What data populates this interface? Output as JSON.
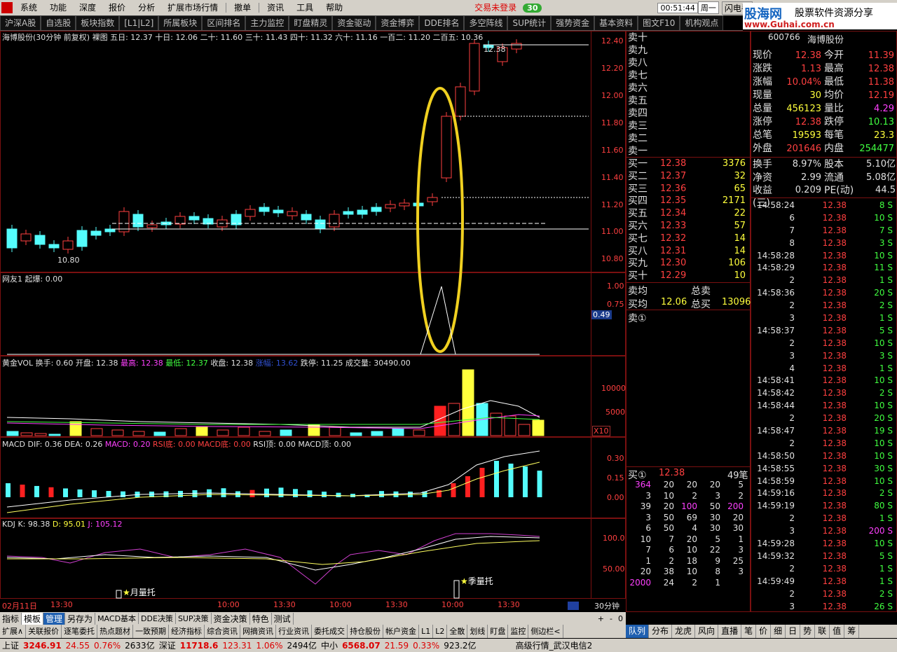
{
  "menu": {
    "items": [
      "系统",
      "功能",
      "深度",
      "报价",
      "分析",
      "扩展市场行情",
      "撤单",
      "资讯",
      "工具",
      "帮助"
    ],
    "login": "交易未登录",
    "badge": "30",
    "time": "00:51:44",
    "weekday": "周一",
    "flash": "闪电手"
  },
  "tabs": [
    "沪深A股",
    "自选股",
    "板块指数",
    "[L1|L2]",
    "所属板块",
    "区间排名",
    "主力监控",
    "盯盘精灵",
    "资金驱动",
    "资金博弈",
    "DDE排名",
    "多空阵线",
    "SUP统计",
    "强势资金",
    "基本资料",
    "图文F10",
    "机构观点"
  ],
  "logo": {
    "name": "股海网",
    "tagline": "股票软件资源分享",
    "url": "www.Guhai.com.cn",
    "stock_code": "600766",
    "stock_name": "海博股份"
  },
  "chart": {
    "title_stock": "海博股份(30分钟 前复权) 裸图",
    "ma": [
      "五日: 12.37",
      "十日: 12.06",
      "二十: 11.60",
      "三十: 11.43",
      "四十: 11.32",
      "六十: 11.16",
      "一百二: 11.20",
      "二百五: 10.36"
    ],
    "price_axis": [
      "12.40",
      "12.20",
      "12.00",
      "11.80",
      "11.60",
      "11.40",
      "11.20",
      "11.00",
      "10.80"
    ],
    "low_label": "10.80",
    "high_label": "12.38",
    "ind1_title": "网友1",
    "ind1_label": "起爆: 0.00",
    "ind1_axis": [
      "1.00",
      "0.75",
      "0.49"
    ],
    "vol_title": "黄金VOL",
    "vol_info": [
      "换手: 0.60",
      "开盘: 12.38",
      "最高: 12.38",
      "最低: 12.37",
      "收盘: 12.38",
      "涨幅: 13.62",
      "跌停: 11.25",
      "成交量: 30490.00"
    ],
    "vol_axis": [
      "10000",
      "5000",
      "X10"
    ],
    "macd_title": "MACD",
    "macd_info": [
      "DIF: 0.36",
      "DEA: 0.26",
      "MACD: 0.20",
      "RSI底: 0.00",
      "MACD底: 0.00",
      "RSI顶: 0.00",
      "MACD顶: 0.00"
    ],
    "macd_axis": [
      "0.30",
      "0.15",
      "0.00"
    ],
    "kdj_title": "KDJ",
    "kdj_info": [
      "K: 98.38",
      "D: 95.01",
      "J: 105.12"
    ],
    "kdj_axis": [
      "100.0",
      "50.00"
    ],
    "ann1": "月量托",
    "ann2": "季量托",
    "time_axis": [
      "02月11日",
      "13:30",
      "10:00",
      "13:30",
      "10:00",
      "13:30",
      "10:00",
      "13:30"
    ],
    "period": "30分钟"
  },
  "orderbook": {
    "sell": [
      "卖十",
      "卖九",
      "卖八",
      "卖七",
      "卖六",
      "卖五",
      "卖四",
      "卖三",
      "卖二",
      "卖一"
    ],
    "buy": [
      {
        "n": "买一",
        "p": "12.38",
        "v": "3376"
      },
      {
        "n": "买二",
        "p": "12.37",
        "v": "32"
      },
      {
        "n": "买三",
        "p": "12.36",
        "v": "65"
      },
      {
        "n": "买四",
        "p": "12.35",
        "v": "2171"
      },
      {
        "n": "买五",
        "p": "12.34",
        "v": "22"
      },
      {
        "n": "买六",
        "p": "12.33",
        "v": "57"
      },
      {
        "n": "买七",
        "p": "12.32",
        "v": "14"
      },
      {
        "n": "买八",
        "p": "12.31",
        "v": "14"
      },
      {
        "n": "买九",
        "p": "12.30",
        "v": "106"
      },
      {
        "n": "买十",
        "p": "12.29",
        "v": "10"
      }
    ],
    "sell_avg": "卖均",
    "total_sell": "总卖",
    "buy_avg": "买均",
    "buy_avg_p": "12.06",
    "total_buy": "总买",
    "total_buy_v": "13096",
    "sell1_label": "卖①",
    "buy1_label": "买①",
    "buy1_p": "12.38",
    "buy1_count": "49笔",
    "queue": [
      [
        "364",
        "20",
        "20",
        "20",
        "5"
      ],
      [
        "3",
        "10",
        "2",
        "3",
        "2"
      ],
      [
        "39",
        "20",
        "100",
        "50",
        "200"
      ],
      [
        "3",
        "50",
        "69",
        "30",
        "20"
      ],
      [
        "6",
        "50",
        "4",
        "30",
        "30"
      ],
      [
        "10",
        "7",
        "20",
        "5",
        "1"
      ],
      [
        "7",
        "6",
        "10",
        "22",
        "3"
      ],
      [
        "1",
        "2",
        "18",
        "9",
        "25"
      ],
      [
        "20",
        "38",
        "10",
        "8",
        "3"
      ],
      [
        "2000",
        "24",
        "2",
        "1",
        ""
      ]
    ]
  },
  "quote": [
    {
      "a": "现价",
      "av": "12.38",
      "b": "今开",
      "bv": "11.39"
    },
    {
      "a": "涨跌",
      "av": "1.13",
      "b": "最高",
      "bv": "12.38"
    },
    {
      "a": "涨幅",
      "av": "10.04%",
      "b": "最低",
      "bv": "11.38"
    },
    {
      "a": "现量",
      "av": "30",
      "b": "均价",
      "bv": "12.19"
    },
    {
      "a": "总量",
      "av": "456123",
      "b": "量比",
      "bv": "4.29"
    },
    {
      "a": "涨停",
      "av": "12.38",
      "b": "跌停",
      "bv": "10.13"
    },
    {
      "a": "总笔",
      "av": "19593",
      "b": "每笔",
      "bv": "23.3"
    },
    {
      "a": "外盘",
      "av": "201646",
      "b": "内盘",
      "bv": "254477"
    }
  ],
  "quote2": [
    {
      "a": "换手",
      "av": "8.97%",
      "b": "股本",
      "bv": "5.10亿"
    },
    {
      "a": "净资",
      "av": "2.99",
      "b": "流通",
      "bv": "5.08亿"
    },
    {
      "a": "收益(三)",
      "av": "0.209",
      "b": "PE(动)",
      "bv": "44.5"
    }
  ],
  "ticks": [
    [
      "14:58:24",
      "12.38",
      "8 S"
    ],
    [
      "6",
      "12.38",
      "10 S"
    ],
    [
      "7",
      "12.38",
      "7 S"
    ],
    [
      "8",
      "12.38",
      "3 S"
    ],
    [
      "14:58:28",
      "12.38",
      "10 S"
    ],
    [
      "14:58:29",
      "12.38",
      "11 S"
    ],
    [
      "2",
      "12.38",
      "1 S"
    ],
    [
      "14:58:36",
      "12.38",
      "20 S"
    ],
    [
      "2",
      "12.38",
      "2 S"
    ],
    [
      "3",
      "12.38",
      "1 S"
    ],
    [
      "14:58:37",
      "12.38",
      "5 S"
    ],
    [
      "2",
      "12.38",
      "10 S"
    ],
    [
      "3",
      "12.38",
      "3 S"
    ],
    [
      "4",
      "12.38",
      "1 S"
    ],
    [
      "14:58:41",
      "12.38",
      "10 S"
    ],
    [
      "14:58:42",
      "12.38",
      "2 S"
    ],
    [
      "14:58:44",
      "12.38",
      "10 S"
    ],
    [
      "2",
      "12.38",
      "20 S"
    ],
    [
      "14:58:47",
      "12.38",
      "19 S"
    ],
    [
      "2",
      "12.38",
      "10 S"
    ],
    [
      "14:58:50",
      "12.38",
      "10 S"
    ],
    [
      "14:58:55",
      "12.38",
      "30 S"
    ],
    [
      "14:58:59",
      "12.38",
      "10 S"
    ],
    [
      "14:59:16",
      "12.38",
      "2 S"
    ],
    [
      "14:59:19",
      "12.38",
      "80 S"
    ],
    [
      "2",
      "12.38",
      "1 S"
    ],
    [
      "3",
      "12.38",
      "200 S"
    ],
    [
      "14:59:28",
      "12.38",
      "10 S"
    ],
    [
      "14:59:32",
      "12.38",
      "5 S"
    ],
    [
      "2",
      "12.38",
      "1 S"
    ],
    [
      "14:59:49",
      "12.38",
      "1 S"
    ],
    [
      "2",
      "12.38",
      "2 S"
    ],
    [
      "3",
      "12.38",
      "26 S"
    ]
  ],
  "bottom_tabs": [
    "指标",
    "模板",
    "管理",
    "另存为",
    "MACD基本",
    "DDE决策",
    "SUP决策",
    "资金决策",
    "特色",
    "测试"
  ],
  "bottom_tabs2": [
    "扩展∧",
    "关联报价",
    "逐笔委托",
    "热点题材",
    "一致预期",
    "经济指标",
    "综合资讯",
    "网摘资讯",
    "行业资讯",
    "委托成交",
    "持仓股份",
    "帐户资金",
    "L1",
    "L2",
    "全散",
    "划线",
    "盯盘",
    "监控",
    "侧边栏<"
  ],
  "right_tabs": [
    "队列",
    "分布",
    "龙虎",
    "风向",
    "直播",
    "笔",
    "价",
    "细",
    "日",
    "势",
    "联",
    "值",
    "筹"
  ],
  "status": {
    "sh": "上证",
    "sh_v": "3246.91",
    "sh_c": "24.55",
    "sh_p": "0.76%",
    "sh_a": "2633亿",
    "sz": "深证",
    "sz_v": "11718.6",
    "sz_c": "123.31",
    "sz_p": "1.06%",
    "sz_a": "2494亿",
    "zx": "中小",
    "zx_v": "6568.07",
    "zx_c": "21.59",
    "zx_p": "0.33%",
    "zx_a": "923.2亿",
    "right": "高级行情_武汉电信2"
  }
}
